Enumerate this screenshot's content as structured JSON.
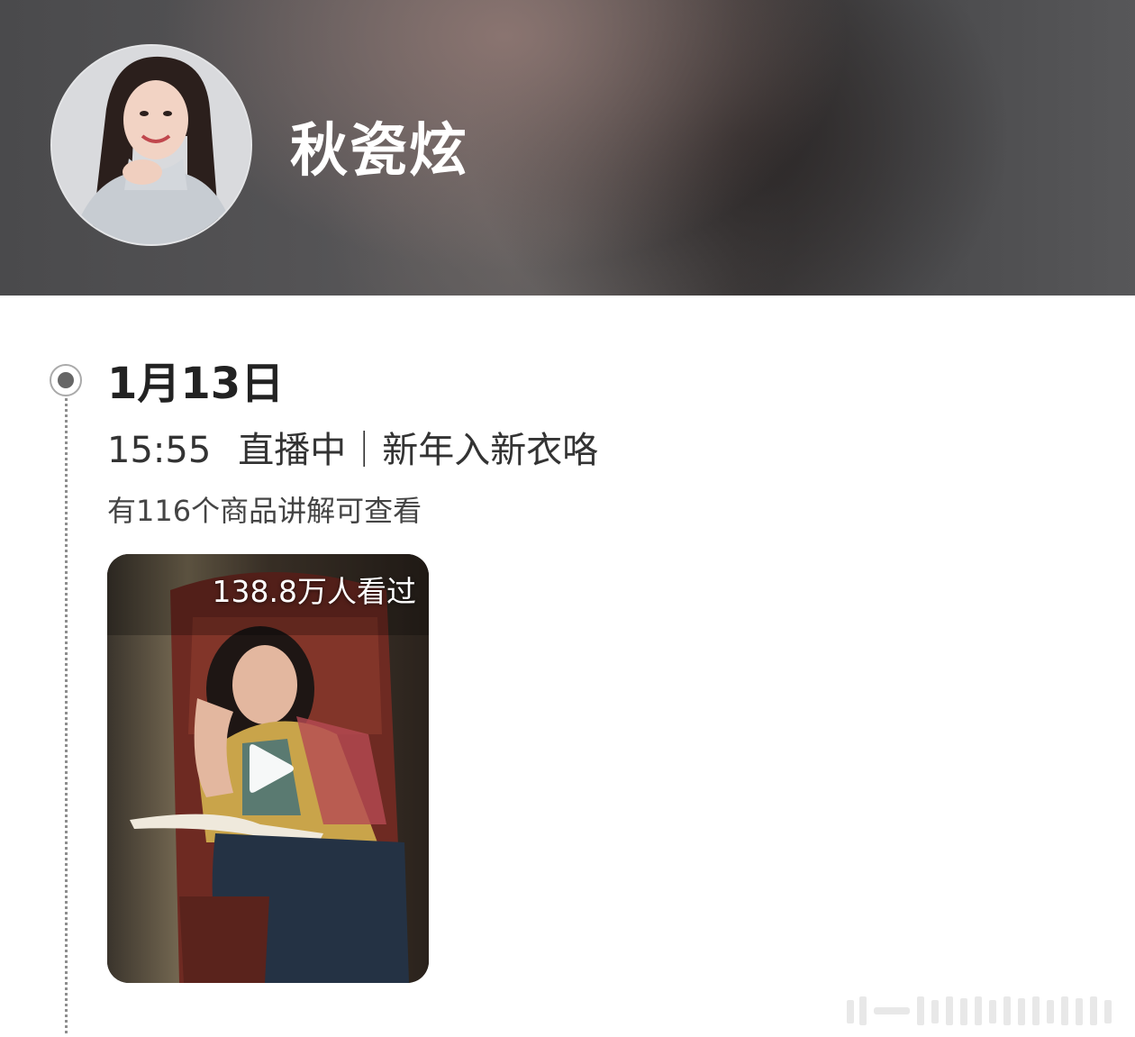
{
  "profile": {
    "name": "秋瓷炫"
  },
  "timeline": {
    "entries": [
      {
        "date": "1月13日",
        "time": "15:55",
        "title": "直播中｜新年入新衣咯",
        "subtitle": "有116个商品讲解可查看",
        "video": {
          "view_count": "138.8万人看过"
        }
      }
    ]
  },
  "icons": {
    "timeline_node": "radio-dot-icon",
    "play": "play-icon"
  },
  "colors": {
    "header_bg": "#4e4c4e",
    "text_primary": "#222222",
    "text_secondary": "#444444",
    "timeline": "#8e8e8e"
  }
}
